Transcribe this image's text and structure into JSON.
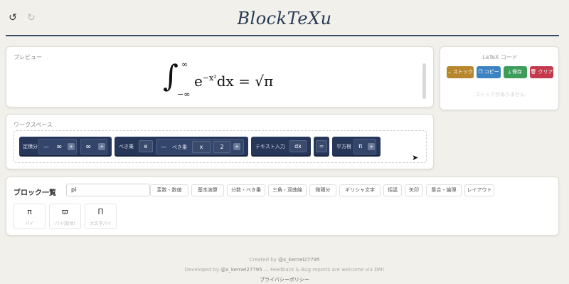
{
  "header": {
    "title": "BlockTeXu",
    "undo_icon": "↺",
    "redo_icon": "↻"
  },
  "preview": {
    "label": "プレビュー",
    "formula": {
      "integral": "∫",
      "upper": "∞",
      "lower": "−∞",
      "base": "e",
      "exponent": "−x²",
      "rest": "dx = √π"
    }
  },
  "latex_panel": {
    "title": "LaTeX コード",
    "buttons": [
      {
        "label": "ストック",
        "icon": "⌄",
        "color": "#b8862c"
      },
      {
        "label": "コピー",
        "icon": "❐",
        "color": "#3c83c4"
      },
      {
        "label": "保存",
        "icon": "⤓",
        "color": "#3f9d5c"
      },
      {
        "label": "クリア",
        "icon": "🗑",
        "color": "#c23a4b"
      }
    ],
    "empty_text": "ストックがありません"
  },
  "workspace": {
    "label": "ワークスペース",
    "integral_block": {
      "label": "定積分",
      "lower_minus": "—",
      "lower_value": "∞",
      "plus": "+",
      "upper_value": "∞",
      "upper_plus": "+"
    },
    "power_block": {
      "label": "べき乗",
      "base": "e",
      "inner": {
        "minus": "—",
        "label": "べき乗",
        "base": "x",
        "exponent": "2",
        "plus": "+"
      }
    },
    "text_block": {
      "label": "テキスト入力",
      "value": "dx"
    },
    "equals_block": {
      "value": "="
    },
    "sqrt_block": {
      "label": "平方根",
      "value": "π",
      "plus": "+"
    }
  },
  "blocks": {
    "title": "ブロック一覧",
    "search_value": "pi",
    "categories": [
      "変数・数値",
      "基本演算",
      "分数・べき乗",
      "三角・双曲線",
      "微積分",
      "ギリシャ文字",
      "括弧",
      "矢印",
      "集合・論理",
      "レイアウト"
    ],
    "results": [
      {
        "symbol": "π",
        "label": "パイ"
      },
      {
        "symbol": "ϖ",
        "label": "パイ(変体)"
      },
      {
        "symbol": "Π",
        "label": "大文字パイ"
      }
    ]
  },
  "footer": {
    "created_prefix": "Created by ",
    "created_handle": "@x_kernel27795",
    "developed_prefix": "Developed by ",
    "developed_handle": "@x_kernel27795",
    "developed_suffix": " — Feedback & Bug reports are welcome via DM!",
    "privacy": "プライバシーポリシー"
  }
}
